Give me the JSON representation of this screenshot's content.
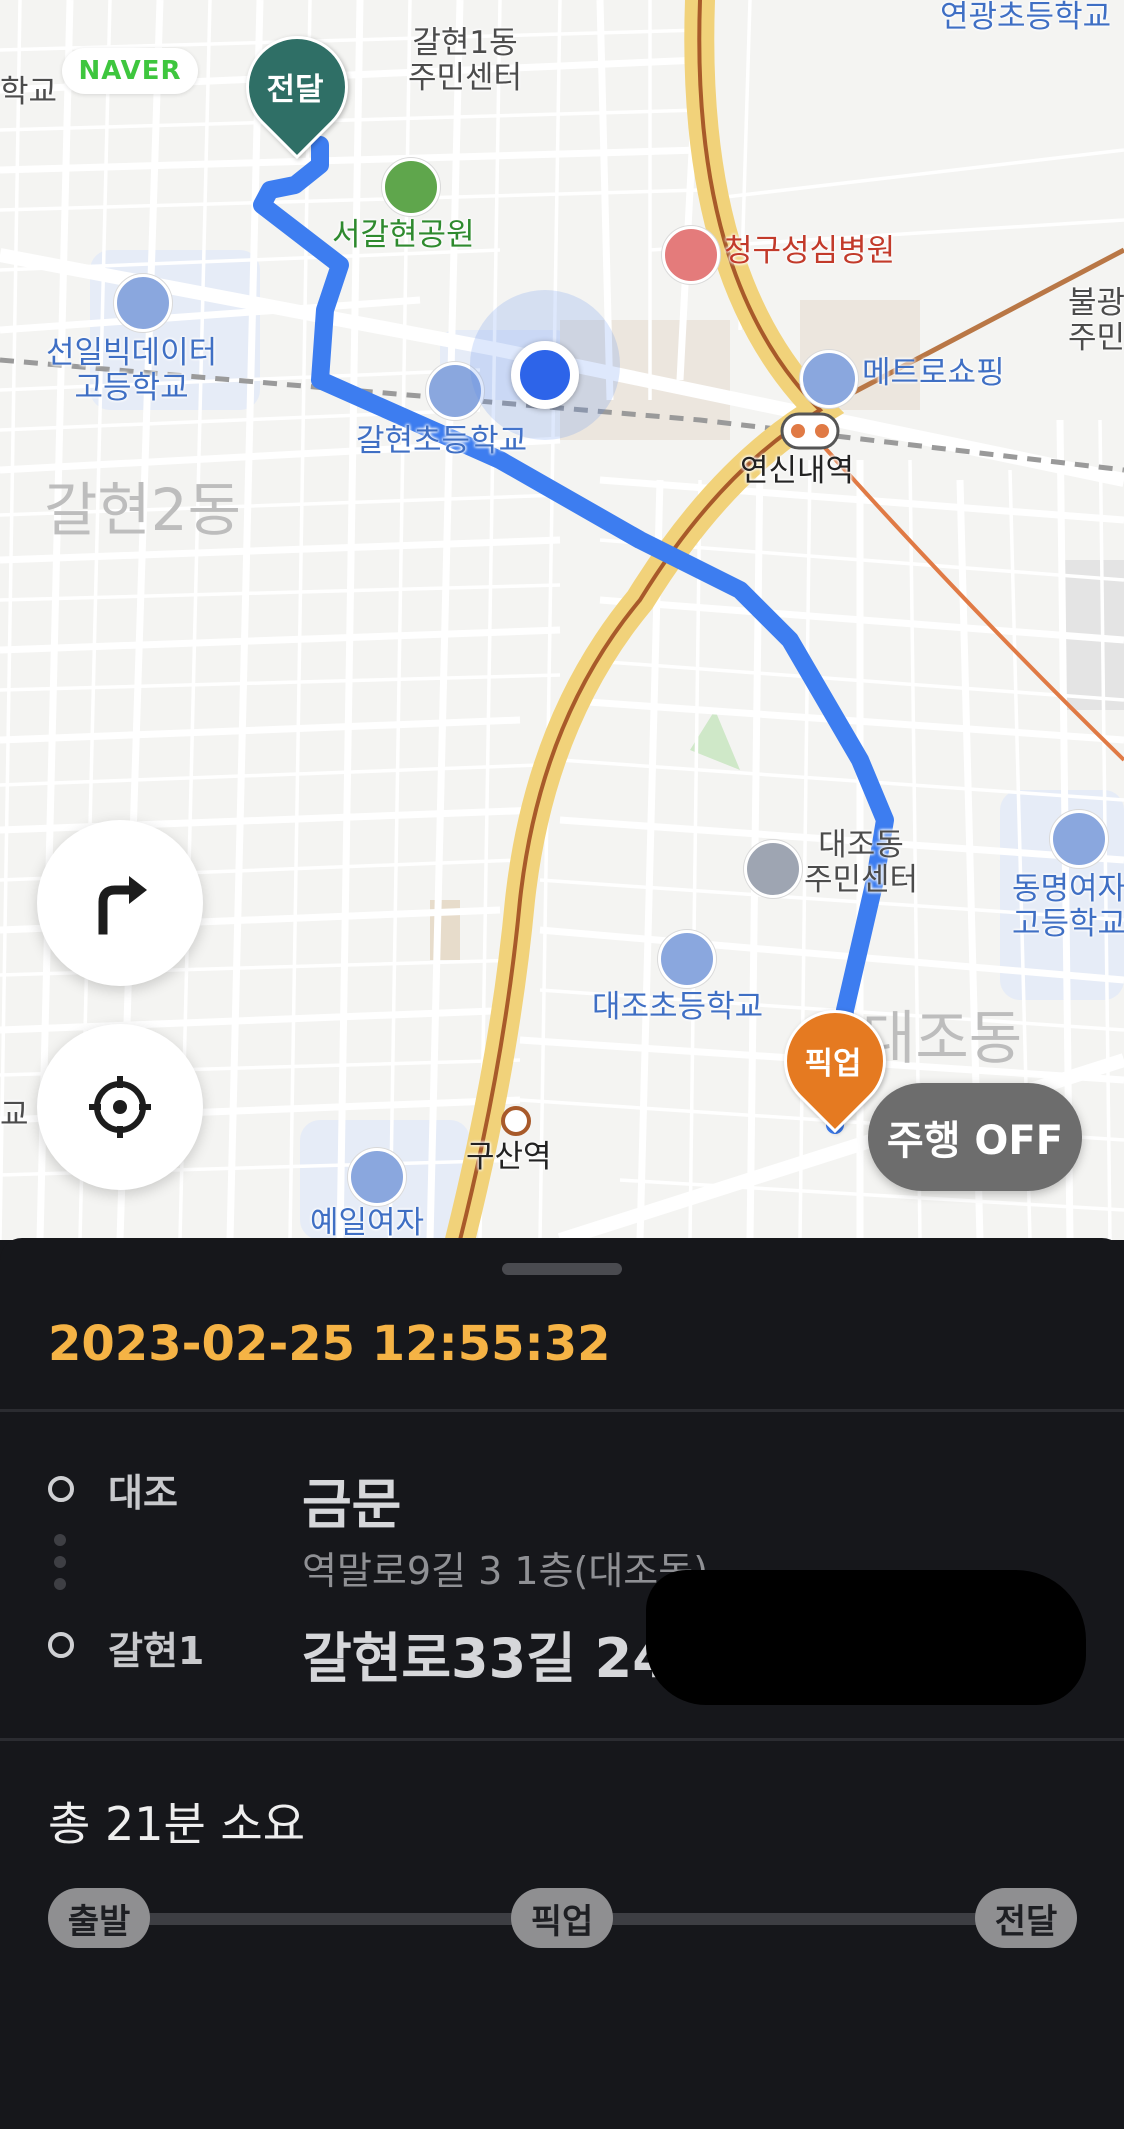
{
  "map": {
    "logo": "NAVER",
    "pins": {
      "destination": "전달",
      "pickup": "픽업"
    },
    "labels": {
      "galhyeon1_center": "갈현1동\n주민센터",
      "school_edge_left": "학교",
      "yeongwang_school": "연광초등학교",
      "seogalhyeon_park": "서갈현공원",
      "cheonggu_hospital": "청구성심병원",
      "bulgwang_center": "불광\n주민",
      "seonil_school": "선일빅데이터\n고등학교",
      "metro_shopping": "메트로쇼핑",
      "galhyeon_elem": "갈현초등학교",
      "yeonsinnae_station": "연신내역",
      "galhyeon2dong": "갈현2동",
      "daejo_center": "대조동\n주민센터",
      "dongmyeong_school": "동명여자\n고등학교",
      "daejo_elem": "대조초등학교",
      "daejodong": "대조동",
      "edge_left_school2": "교",
      "gusan_station": "구산역",
      "yeil_school": "예일여자"
    },
    "drive_button": "주행 OFF",
    "icons": {
      "turn": "turn-right-arrow-icon",
      "locate": "crosshair-icon"
    },
    "colors": {
      "route": "#3d7df0",
      "dest_pin": "#2f6f66",
      "pickup_pin": "#e57a21"
    }
  },
  "sheet": {
    "datetime": "2023-02-25 12:55:32",
    "pickup": {
      "area": "대조",
      "name": "금문",
      "address": "역말로9길 3 1층(대조동)"
    },
    "dropoff": {
      "area": "갈현1",
      "address": "갈현로33길 24"
    },
    "total_time": "총 21분 소요",
    "progress_steps": [
      "출발",
      "픽업",
      "전달"
    ],
    "colors": {
      "datetime": "#f5b345",
      "background": "#16171b"
    }
  }
}
